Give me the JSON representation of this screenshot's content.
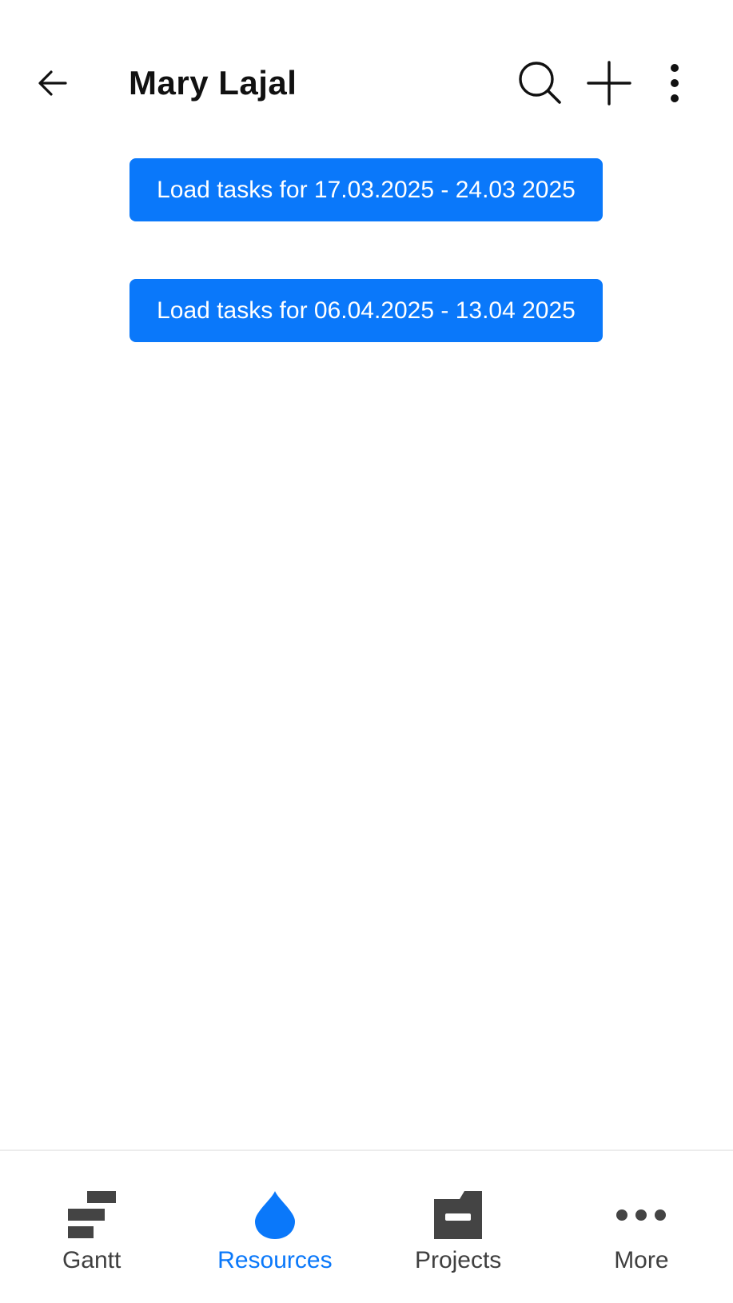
{
  "header": {
    "title": "Mary Lajal",
    "back_icon": "arrow-left-icon",
    "search_icon": "search-icon",
    "add_icon": "plus-icon",
    "more_icon": "more-vertical-icon"
  },
  "main": {
    "load_buttons": [
      {
        "label": "Load tasks for 17.03.2025 - 24.03 2025"
      },
      {
        "label": "Load tasks for 06.04.2025 - 13.04 2025"
      }
    ]
  },
  "bottom_nav": {
    "items": [
      {
        "label": "Gantt",
        "icon": "gantt-icon",
        "active": false
      },
      {
        "label": "Resources",
        "icon": "drop-icon",
        "active": true
      },
      {
        "label": "Projects",
        "icon": "folder-icon",
        "active": false
      },
      {
        "label": "More",
        "icon": "more-horizontal-icon",
        "active": false
      }
    ]
  },
  "colors": {
    "accent": "#0a78fa",
    "icon_dark": "#444444",
    "text_dark": "#111111"
  }
}
